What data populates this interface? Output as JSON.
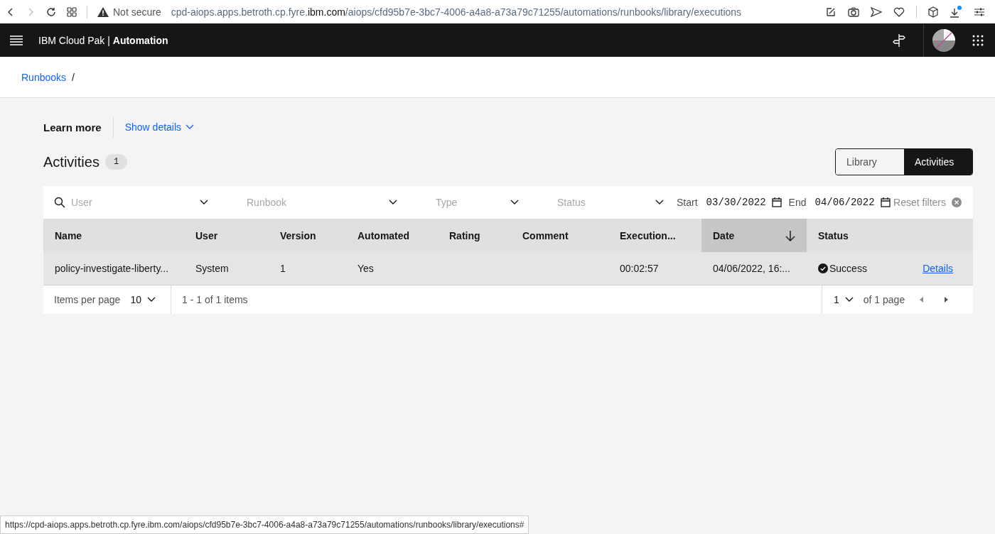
{
  "browser": {
    "not_secure": "Not secure",
    "url_prefix": "cpd-aiops.apps.betroth.cp.fyre.",
    "url_domain": "ibm.com",
    "url_path": "/aiops/cfd95b7e-3bc7-4006-a4a8-a73a79c71255/automations/runbooks/library/executions"
  },
  "header": {
    "brand": "IBM Cloud Pak",
    "separator": "|",
    "product": "Automation"
  },
  "breadcrumb": {
    "items": [
      "Runbooks"
    ],
    "separator": "/"
  },
  "learn_more": {
    "label": "Learn more",
    "link": "Show details"
  },
  "section": {
    "title": "Activities",
    "count": "1"
  },
  "view_switch": [
    {
      "label": "Library",
      "selected": false
    },
    {
      "label": "Activities",
      "selected": true
    }
  ],
  "filters": [
    {
      "kind": "search-select",
      "placeholder": "User"
    },
    {
      "kind": "select",
      "placeholder": "Runbook"
    },
    {
      "kind": "select",
      "placeholder": "Type"
    },
    {
      "kind": "select",
      "placeholder": "Status"
    },
    {
      "kind": "date",
      "label": "Start",
      "value": "03/30/2022"
    },
    {
      "kind": "date",
      "label": "End",
      "value": "04/06/2022"
    },
    {
      "kind": "reset",
      "label": "Reset filters"
    }
  ],
  "table": {
    "columns": [
      {
        "label": "Name",
        "sorted": false
      },
      {
        "label": "User",
        "sorted": false
      },
      {
        "label": "Version",
        "sorted": false
      },
      {
        "label": "Automated",
        "sorted": false
      },
      {
        "label": "Rating",
        "sorted": false
      },
      {
        "label": "Comment",
        "sorted": false
      },
      {
        "label": "Execution...",
        "sorted": false
      },
      {
        "label": "Date",
        "sorted": true
      },
      {
        "label": "Status",
        "sorted": false
      }
    ],
    "rows": [
      {
        "cells": [
          "policy-investigate-liberty...",
          "System",
          "1",
          "Yes",
          "",
          "",
          "00:02:57",
          "04/06/2022, 16:..."
        ],
        "status": "Success",
        "link": "Details"
      }
    ]
  },
  "pagination": {
    "items_label": "Items per page",
    "page_size": "10",
    "range": "1 - 1 of 1 items",
    "page": "1",
    "of_pages": "of 1 page"
  },
  "status_url": "https://cpd-aiops.apps.betroth.cp.fyre.ibm.com/aiops/cfd95b7e-3bc7-4006-a4a8-a73a79c71255/automations/runbooks/library/executions#"
}
